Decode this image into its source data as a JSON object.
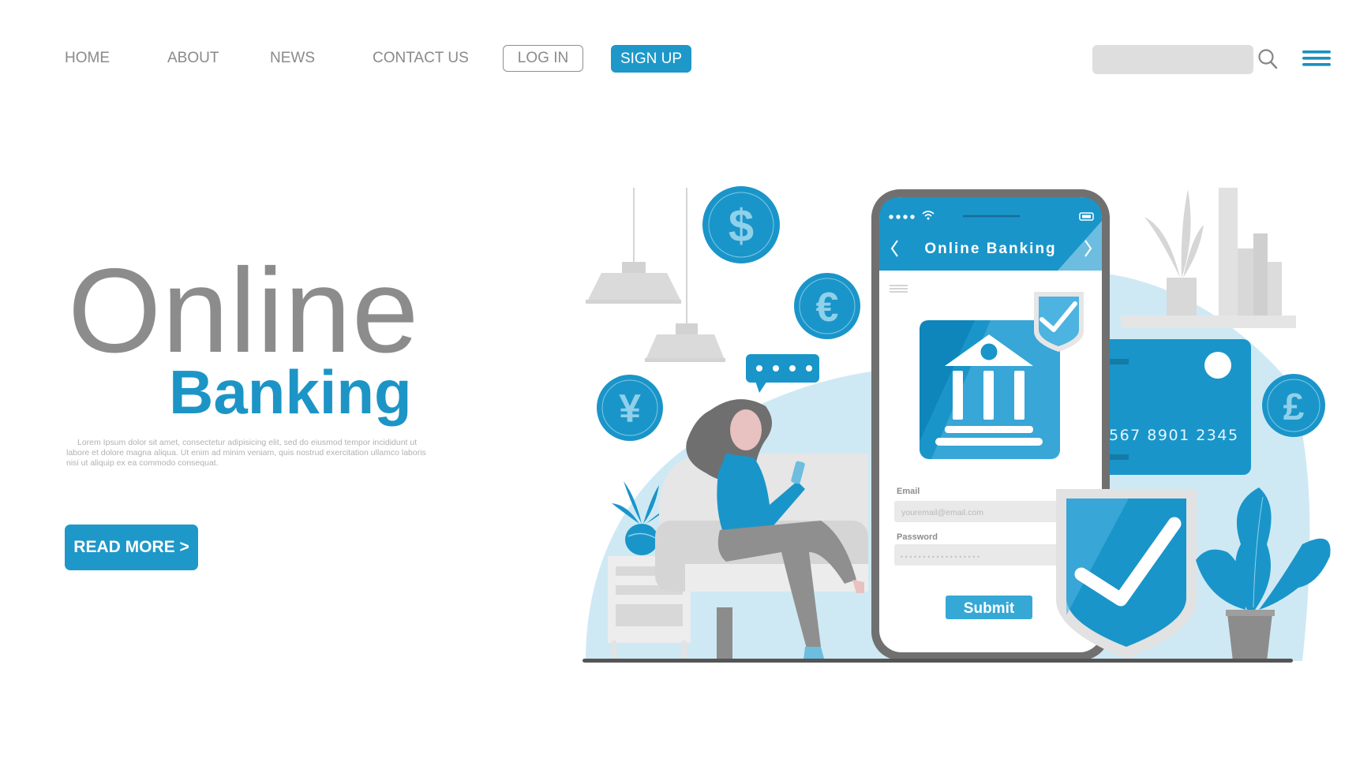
{
  "nav": {
    "links": [
      "HOME",
      "ABOUT",
      "NEWS",
      "CONTACT US"
    ],
    "login_label": "LOG IN",
    "signup_label": "SIGN UP",
    "search_placeholder": "",
    "search_icon": "search-icon",
    "menu_icon": "hamburger-menu-icon"
  },
  "hero": {
    "title_line1": "Online",
    "title_line2": "Banking",
    "description": "Lorem Ipsum dolor sit amet, consectetur adipisicing elit, sed do eiusmod tempor incididunt ut labore et dolore magna aliqua. Ut enim ad minim veniam, quis nostrud exercitation ullamco laboris nisi ut aliquip ex ea commodo consequat.",
    "read_more_label": "READ MORE  >"
  },
  "illustration": {
    "phone": {
      "title": "Online Banking",
      "back_icon": "chevron-left-icon",
      "forward_icon": "chevron-right-icon",
      "email_label": "Email",
      "email_placeholder": "youremail@email.com",
      "password_label": "Password",
      "password_value": "••••••••••••••••••",
      "submit_label": "Submit"
    },
    "card_number": "567 8901 2345",
    "coins": [
      "$",
      "€",
      "¥",
      "£"
    ],
    "chat_bubble": "• • • •"
  },
  "colors": {
    "accent": "#1e98c9",
    "accent_light": "#cfe9f4",
    "text_gray": "#8c8c8c",
    "light_gray": "#dedede"
  }
}
